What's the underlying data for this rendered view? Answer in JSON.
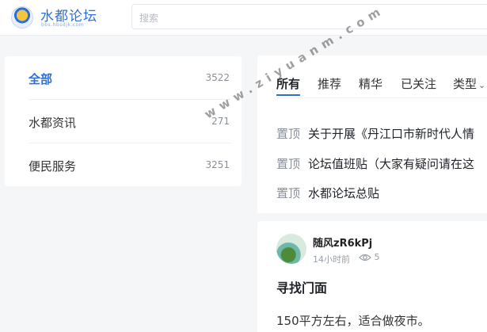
{
  "header": {
    "logo_title": "水都论坛",
    "logo_sub": "bbs.hbsdjk.com",
    "search_placeholder": "搜索"
  },
  "categories": [
    {
      "label": "全部",
      "count": "3522",
      "active": true
    },
    {
      "label": "水都资讯",
      "count": "271",
      "active": false
    },
    {
      "label": "便民服务",
      "count": "3251",
      "active": false
    }
  ],
  "feed": {
    "tabs": [
      "所有",
      "推荐",
      "精华",
      "已关注",
      "类型"
    ],
    "pinned_badge": "置顶",
    "pinned": [
      "关于开展《丹江口市新时代人情",
      "论坛值班贴（大家有疑问请在这",
      "水都论坛总贴"
    ]
  },
  "post": {
    "author": "随风zR6kPj",
    "time": "14小时前",
    "views": "5",
    "title": "寻找门面",
    "body": "150平方左右，适合做夜市。"
  },
  "watermark": "www.ziyuanm.com",
  "colors": {
    "accent": "#2f6fd1",
    "background": "#f5f6f8"
  }
}
